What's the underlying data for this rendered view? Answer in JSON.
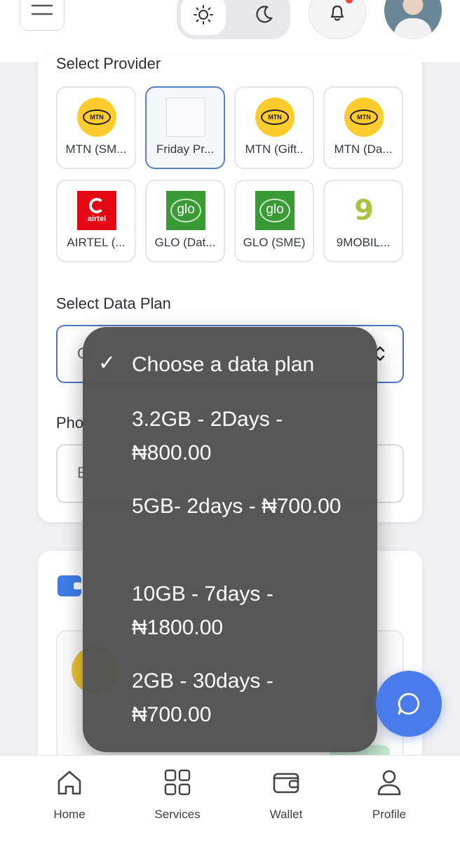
{
  "header": {
    "icons": [
      "menu-icon",
      "sun-icon",
      "moon-icon",
      "bell-icon",
      "avatar"
    ]
  },
  "providers_section": {
    "title": "Select Provider",
    "items": [
      {
        "label": "MTN (SM...",
        "logo": "mtn-logo"
      },
      {
        "label": "Friday Pr...",
        "logo": "blank-logo",
        "selected": true
      },
      {
        "label": "MTN (Gift..",
        "logo": "mtn-logo"
      },
      {
        "label": "MTN (Da...",
        "logo": "mtn-logo"
      },
      {
        "label": "AIRTEL (...",
        "logo": "airtel-logo",
        "logo_text": "airtel"
      },
      {
        "label": "GLO (Dat...",
        "logo": "glo-logo",
        "logo_text": "glo"
      },
      {
        "label": "GLO (SME)",
        "logo": "glo-logo",
        "logo_text": "glo"
      },
      {
        "label": "9MOBIL...",
        "logo": "9mobile-logo"
      }
    ],
    "mtn_logo_text": "MTN"
  },
  "data_plan": {
    "label": "Select Data Plan",
    "select_value": "C",
    "chevron": "⌃⌄",
    "options": [
      {
        "text": "Choose a data plan",
        "checked": true
      },
      {
        "text": "3.2GB - 2Days - ₦800.00"
      },
      {
        "text": "5GB- 2days - ₦700.00"
      },
      {
        "text": "10GB - 7days - ₦1800.00"
      },
      {
        "text": "2GB - 30days - ₦700.00"
      }
    ],
    "check_mark": "✓"
  },
  "phone": {
    "label": "Pho",
    "placeholder": "E"
  },
  "colors": {
    "accent": "#4b7bea",
    "mtn_yellow": "#ffcc2e",
    "airtel_red": "#e40613",
    "glo_green": "#3a9a35",
    "dropdown_bg": "#525252"
  },
  "bottom_nav": {
    "items": [
      {
        "label": "Home",
        "icon": "home-icon"
      },
      {
        "label": "Services",
        "icon": "grid-icon"
      },
      {
        "label": "Wallet",
        "icon": "wallet-icon"
      },
      {
        "label": "Profile",
        "icon": "user-icon"
      }
    ]
  }
}
